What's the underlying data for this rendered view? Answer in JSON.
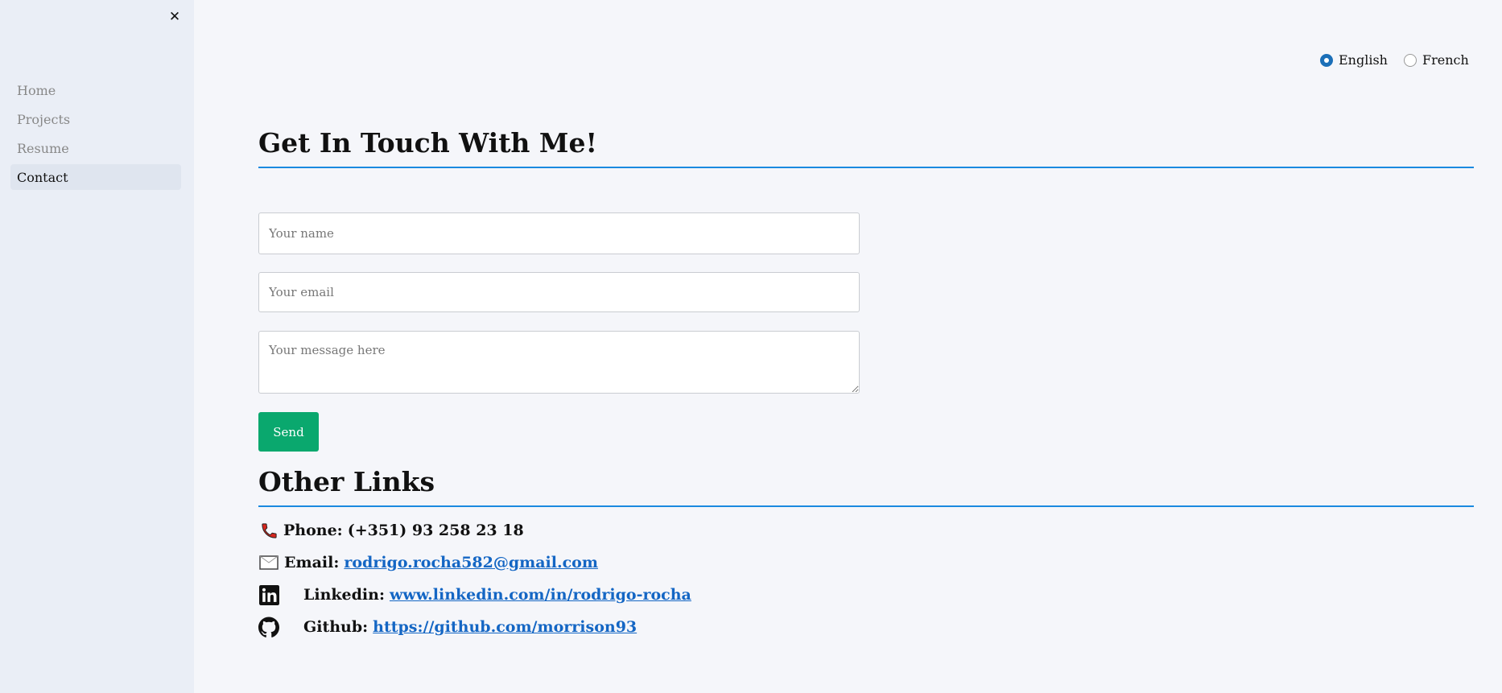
{
  "sidebar": {
    "close_glyph": "✕",
    "items": [
      {
        "label": "Home",
        "active": false
      },
      {
        "label": "Projects",
        "active": false
      },
      {
        "label": "Resume",
        "active": false
      },
      {
        "label": "Contact",
        "active": true
      }
    ]
  },
  "language": {
    "options": [
      {
        "label": "English",
        "selected": true
      },
      {
        "label": "French",
        "selected": false
      }
    ]
  },
  "contact": {
    "title": "Get In Touch With Me!",
    "name_placeholder": "Your name",
    "email_placeholder": "Your email",
    "message_placeholder": "Your message here",
    "send_label": "Send"
  },
  "other_links": {
    "title": "Other Links",
    "phone": {
      "label": "Phone:",
      "value": "(+351) 93 258 23 18",
      "icon": "phone-icon"
    },
    "email": {
      "label": "Email:",
      "value": "rodrigo.rocha582@gmail.com",
      "icon": "envelope-icon"
    },
    "linkedin": {
      "label": "Linkedin:",
      "value": "www.linkedin.com/in/rodrigo-rocha",
      "icon": "linkedin-icon"
    },
    "github": {
      "label": "Github:",
      "value": "https://github.com/morrison93",
      "icon": "github-icon"
    }
  },
  "colors": {
    "accent_rule": "#1a8ae0",
    "send_button": "#0aa86e",
    "link": "#1466c4",
    "radio_selected": "#1b6fb8"
  }
}
